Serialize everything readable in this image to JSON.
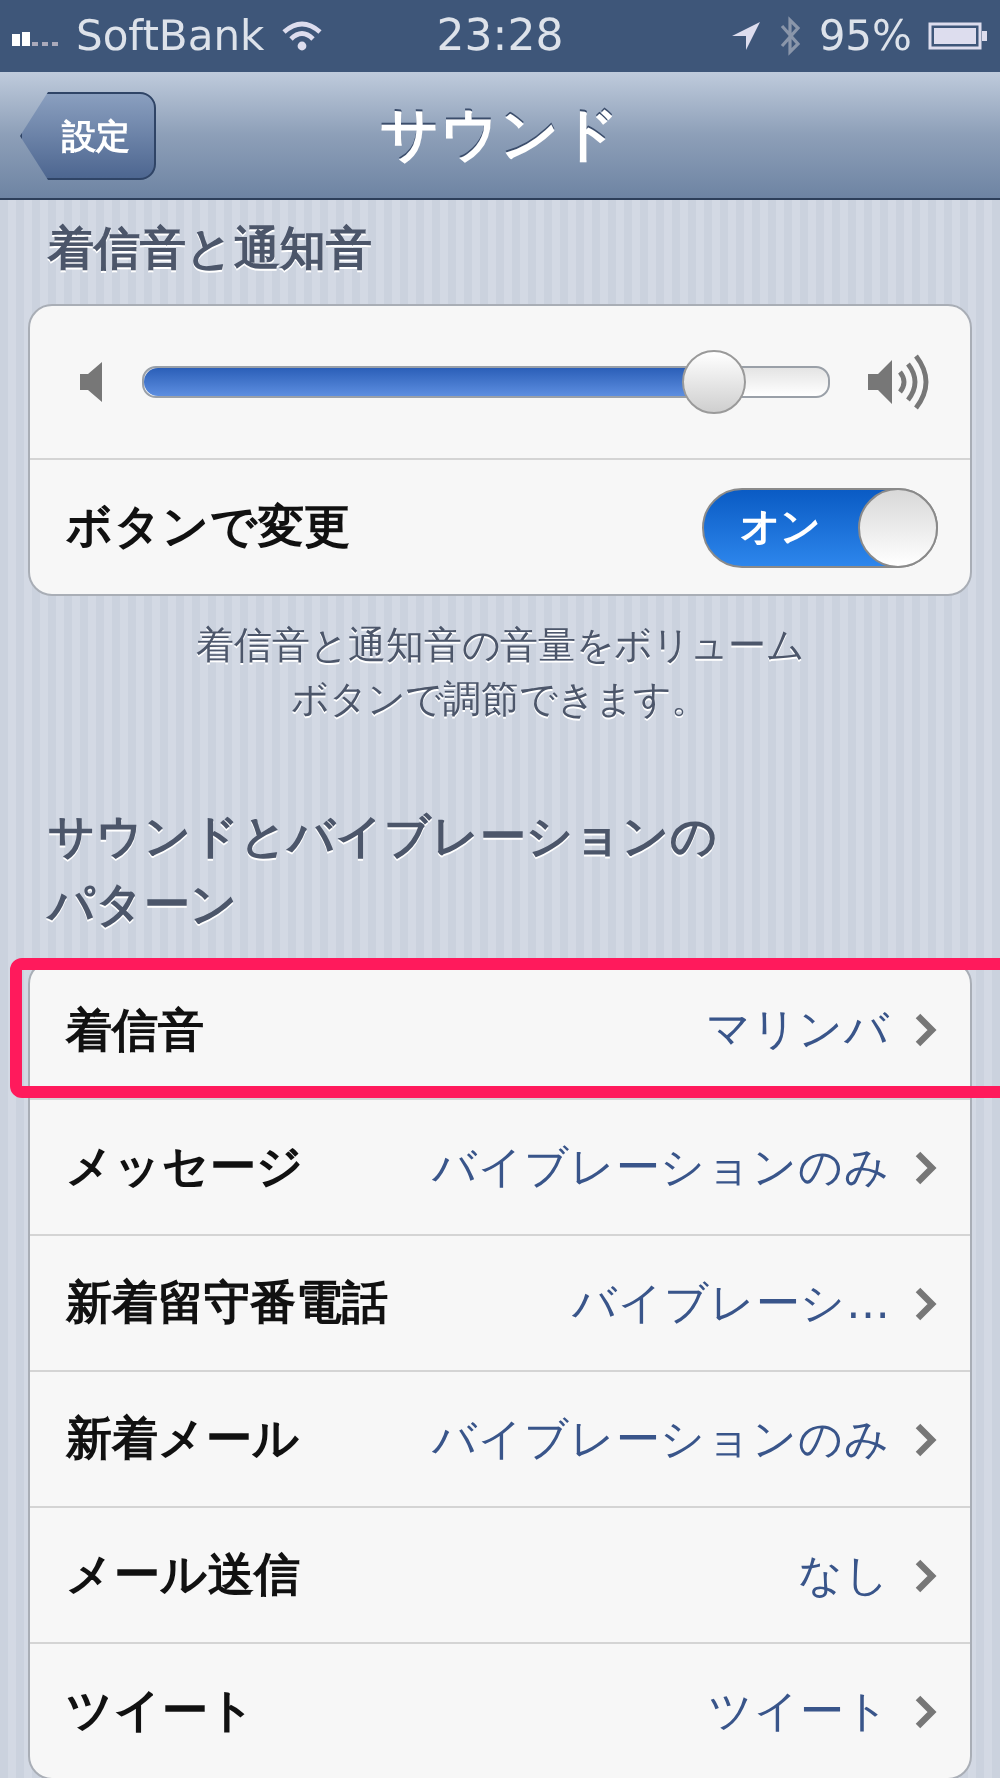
{
  "status_bar": {
    "carrier": "SoftBank",
    "time": "23:28",
    "battery": "95%"
  },
  "nav_bar": {
    "back": "設定",
    "title": "サウンド"
  },
  "sections": [
    {
      "header": [
        "着信音と通知音"
      ],
      "footer": [
        "着信音と通知音の音量をボリューム",
        "ボタンで調節できます。"
      ],
      "rows": [
        {
          "kind": "slider",
          "level": 0.83
        },
        {
          "kind": "switch",
          "label": "ボタンで変更",
          "on": true,
          "switch_text": "オン"
        }
      ]
    },
    {
      "header": [
        "サウンドとバイブレーションの",
        "パターン"
      ],
      "rows": [
        {
          "kind": "link",
          "label": "着信音",
          "value": "マリンバ",
          "highlighted": true
        },
        {
          "kind": "link",
          "label": "メッセージ",
          "value": "バイブレーションのみ",
          "highlighted": false
        },
        {
          "kind": "link",
          "label": "新着留守番電話",
          "value": "バイブレーシ…",
          "highlighted": false
        },
        {
          "kind": "link",
          "label": "新着メール",
          "value": "バイブレーションのみ",
          "highlighted": false
        },
        {
          "kind": "link",
          "label": "メール送信",
          "value": "なし",
          "highlighted": false
        },
        {
          "kind": "link",
          "label": "ツイート",
          "value": "ツイート",
          "highlighted": false
        }
      ]
    }
  ]
}
